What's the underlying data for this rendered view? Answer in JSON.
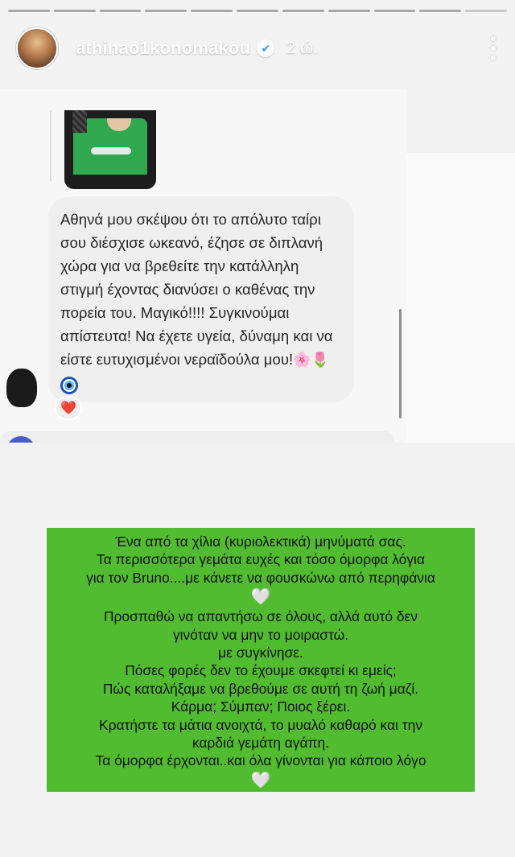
{
  "story": {
    "segments_total": 11,
    "segments_done": 10
  },
  "header": {
    "username": "athinao1konomakou",
    "verified_icon": "✔",
    "time": "2 ώ.",
    "more_icon": "more-vertical-icon"
  },
  "dm_screenshot": {
    "thumbnail_caption": "",
    "message": "Αθηνά μου σκέψου ότι το απόλυτο ταίρι σου διέσχισε ωκεανό, έζησε σε διπλανή χώρα για να βρεθείτε την κατάλληλη στιγμή έχοντας διανύσει ο καθένας την πορεία του. Μαγικό!!!! Συγκινούμαι απίστευτα! Να έχετε υγεία, δύναμη και να είστε ευτυχισμένοι νεραϊδούλα μου!",
    "message_emojis": "🌸🌷",
    "reaction": "❤️"
  },
  "note": {
    "lines": [
      "Ένα από τα χίλια (κυριολεκτικά) μηνύματά σας.",
      "Τα περισσότερα γεμάτα ευχές και τόσο όμορφα λόγια",
      "για τον Bruno....με κάνετε να φουσκώνω από περηφάνια"
    ],
    "heart": "🤍",
    "lines2": [
      "Προσπαθώ να απαντήσω σε όλους, αλλά αυτό δεν",
      "γινόταν να μην το μοιραστώ.",
      "με συγκίνησε.",
      "Πόσες φορές δεν το έχουμε σκεφτεί κι εμείς;",
      "Πώς καταλήξαμε να βρεθούμε σε αυτή τη ζωή μαζί.",
      "Κάρμα; Σύμπαν; Ποιος ξέρει.",
      "Κρατήστε τα μάτια ανοιχτά, το μυαλό καθαρό και την",
      "καρδιά γεμάτη αγάπη.",
      "Τα όμορφα έρχονται..και όλα γίνονται για κάποιο λόγο"
    ],
    "heart2": "🤍"
  }
}
